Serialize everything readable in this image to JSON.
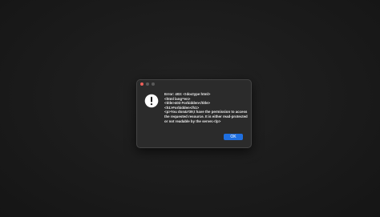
{
  "dialog": {
    "message": "Error: 403: <!doctype html>\n<html lang=en>\n<title>403 Forbidden</title>\n<h1>Forbidden</h1>\n<p>You don&#39;t have the permission to access the requested resource. It is either read-protected or not readable by the server.</p>",
    "ok_label": "OK",
    "icon": "exclamation-alert-icon"
  },
  "window_controls": {
    "close_color": "#ec5f5a",
    "inactive_color": "#5a5a5a"
  },
  "colors": {
    "desktop": "#1b1b1b",
    "dialog_bg": "#2b2b2b",
    "accent": "#1f6fe0",
    "text": "#eaeaea"
  }
}
